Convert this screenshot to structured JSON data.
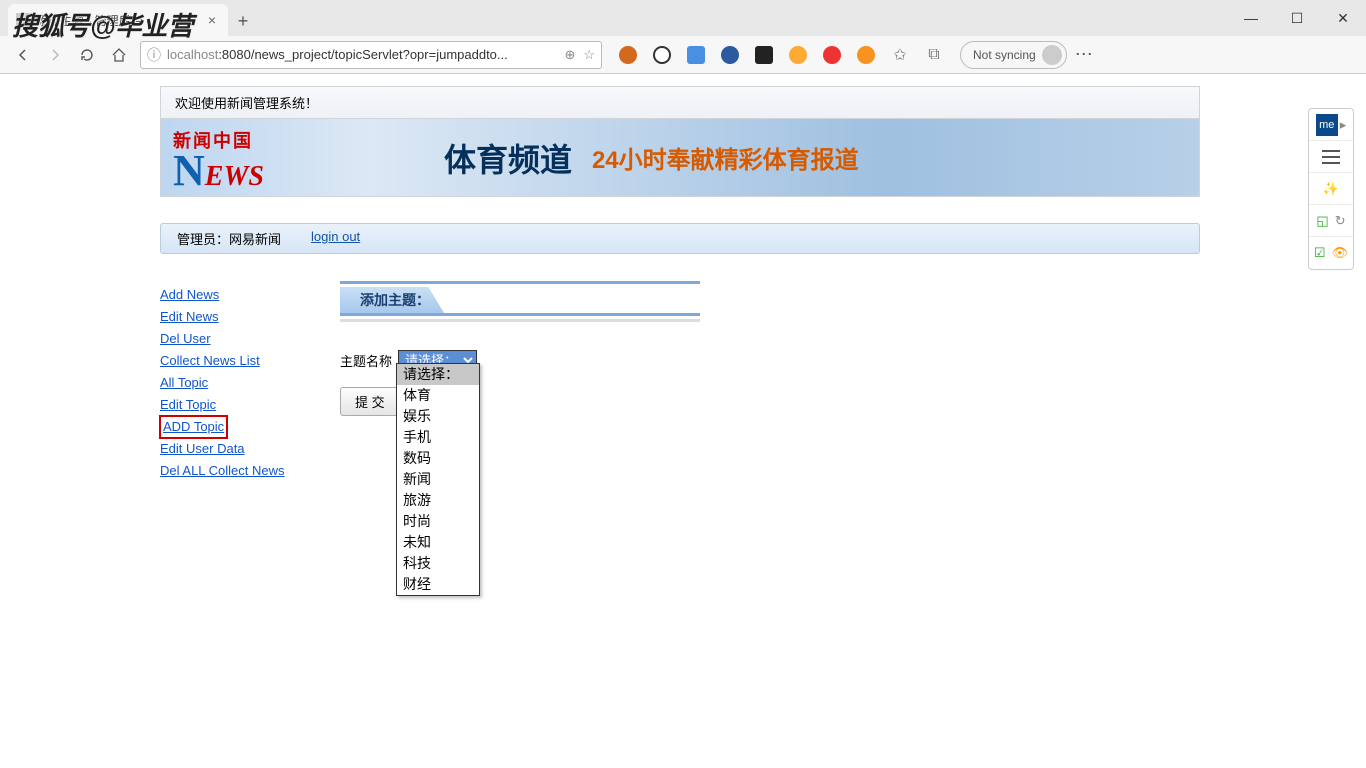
{
  "watermark": "搜狐号@毕业营",
  "browser": {
    "tab_title": "添加主题 - 管理后台",
    "url_host": "localhost",
    "url_port_path": ":8080/news_project/topicServlet?opr=jumpaddto...",
    "not_syncing": "Not syncing"
  },
  "welcome": "欢迎使用新闻管理系统！",
  "banner": {
    "brand_cn": "新闻中国",
    "channel": "体育频道",
    "slogan": "24小时奉献精彩体育报道"
  },
  "admin_bar": {
    "label": "管理员：网易新闻",
    "logout": "login out"
  },
  "sidebar": {
    "items": [
      {
        "label": "Add News"
      },
      {
        "label": "Edit News"
      },
      {
        "label": "Del User"
      },
      {
        "label": "Collect News List"
      },
      {
        "label": "All Topic"
      },
      {
        "label": "Edit Topic"
      },
      {
        "label": "ADD Topic",
        "selected": true
      },
      {
        "label": "Edit User Data"
      },
      {
        "label": "Del ALL Collect News"
      }
    ]
  },
  "form": {
    "section_title": "添加主题：",
    "field_label": "主题名称",
    "select_value": "请选择：",
    "submit_label": "提 交",
    "options": [
      "请选择：",
      "体育",
      "娱乐",
      "手机",
      "数码",
      "新闻",
      "旅游",
      "时尚",
      "未知",
      "科技",
      "财经"
    ]
  }
}
